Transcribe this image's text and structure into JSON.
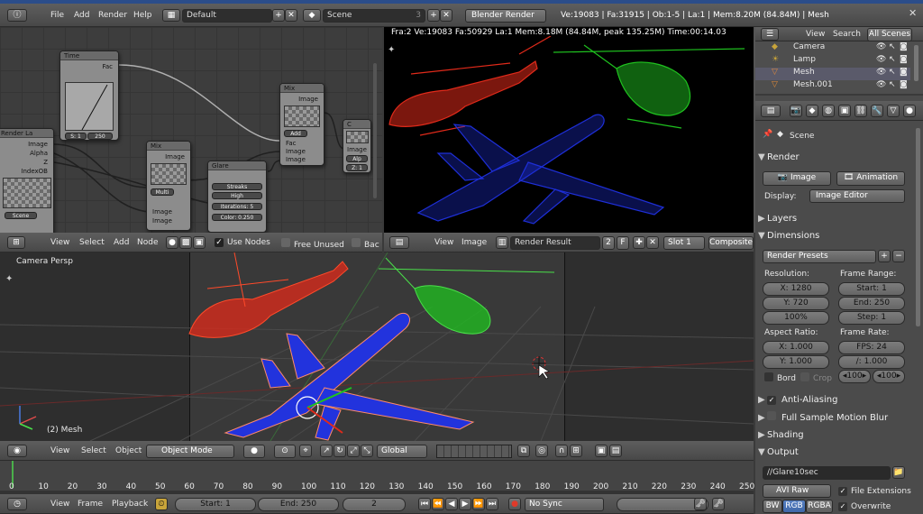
{
  "menu": {
    "items": [
      "File",
      "Add",
      "Render",
      "Help"
    ],
    "screen": "Default",
    "scene": "Scene",
    "scene_users": "3",
    "engine": "Blender Render",
    "stats": "Ve:19083 | Fa:31915 | Ob:1-5 | La:1 | Mem:8.20M (84.84M) | Mesh"
  },
  "node_editor": {
    "footer": {
      "view": "View",
      "select": "Select",
      "add": "Add",
      "node": "Node",
      "use_nodes": "Use Nodes",
      "free_unused": "Free Unused",
      "backdrop": "Bac"
    },
    "nodes": {
      "render_layers": {
        "title": "Render La",
        "outputs": [
          "Image",
          "Alpha",
          "Z",
          "IndexOB"
        ],
        "scene": "Scene"
      },
      "time": {
        "title": "Time",
        "fac": "Fac",
        "start": "S: 1",
        "end": "250"
      },
      "mix1": {
        "title": "Mix",
        "image": "Image",
        "mode": "Multi",
        "inputs": [
          "Image",
          "Image"
        ]
      },
      "glare": {
        "title": "Glare",
        "type": "Streaks",
        "quality": "High",
        "iterations": "Iterations: 5",
        "color": "Color: 0.250"
      },
      "mix2": {
        "title": "Mix",
        "image": "Image",
        "mode": "Add",
        "fac": "Fac",
        "inputs": [
          "Image",
          "Image"
        ]
      },
      "composite": {
        "title": "C",
        "image": "Image",
        "alpha": "Alp",
        "z": "Z: 1"
      }
    }
  },
  "image_editor": {
    "info": "Fra:2  Ve:19083 Fa:50929 La:1 Mem:8.18M (84.84M, peak 135.25M) Time:00:14.03",
    "footer": {
      "view": "View",
      "image": "Image",
      "result": "Render Result",
      "users": "2",
      "fake": "F",
      "slot": "Slot 1",
      "pass": "Composite"
    }
  },
  "viewport": {
    "label": "Camera Persp",
    "object": "(2) Mesh",
    "footer": {
      "view": "View",
      "select": "Select",
      "object": "Object",
      "mode": "Object Mode",
      "orientation": "Global"
    }
  },
  "timeline": {
    "ticks": [
      "0",
      "10",
      "20",
      "30",
      "40",
      "50",
      "60",
      "70",
      "80",
      "90",
      "100",
      "110",
      "120",
      "130",
      "140",
      "150",
      "160",
      "170",
      "180",
      "190",
      "200",
      "210",
      "220",
      "230",
      "240",
      "250"
    ],
    "view": "View",
    "frame": "Frame",
    "playback": "Playback",
    "start": "Start: 1",
    "end": "End: 250",
    "current": "2",
    "sync": "No Sync"
  },
  "outliner": {
    "view": "View",
    "search": "Search",
    "filter": "All Scenes",
    "items": [
      "Camera",
      "Lamp",
      "Mesh",
      "Mesh.001"
    ]
  },
  "properties": {
    "context": "Scene",
    "render": {
      "title": "Render",
      "image": "Image",
      "animation": "Animation",
      "display_label": "Display:",
      "display": "Image Editor"
    },
    "layers": "Layers",
    "dimensions": {
      "title": "Dimensions",
      "presets": "Render Presets",
      "resolution": "Resolution:",
      "x": "X: 1280",
      "y": "Y: 720",
      "pct": "100%",
      "frame_range": "Frame Range:",
      "start": "Start: 1",
      "end": "End: 250",
      "step": "Step: 1",
      "aspect": "Aspect Ratio:",
      "ax": "X: 1.000",
      "ay": "Y: 1.000",
      "frame_rate": "Frame Rate:",
      "fps": "FPS: 24",
      "base": "/: 1.000",
      "border": "Bord",
      "crop": "Crop",
      "old": "100",
      "new": "100"
    },
    "antialiasing": "Anti-Aliasing",
    "motion_blur": "Full Sample Motion Blur",
    "shading": "Shading",
    "output": {
      "title": "Output",
      "path": "//Glare10sec",
      "format": "AVI Raw",
      "extensions": "File Extensions",
      "bw": "BW",
      "rgb": "RGB",
      "rgba": "RGBA",
      "overwrite": "Overwrite"
    }
  },
  "colors": {
    "accent": "#5680c2",
    "heli_red": "#e02a1a",
    "heli_green": "#1fc21f",
    "plane_blue": "#1e2fd8"
  }
}
